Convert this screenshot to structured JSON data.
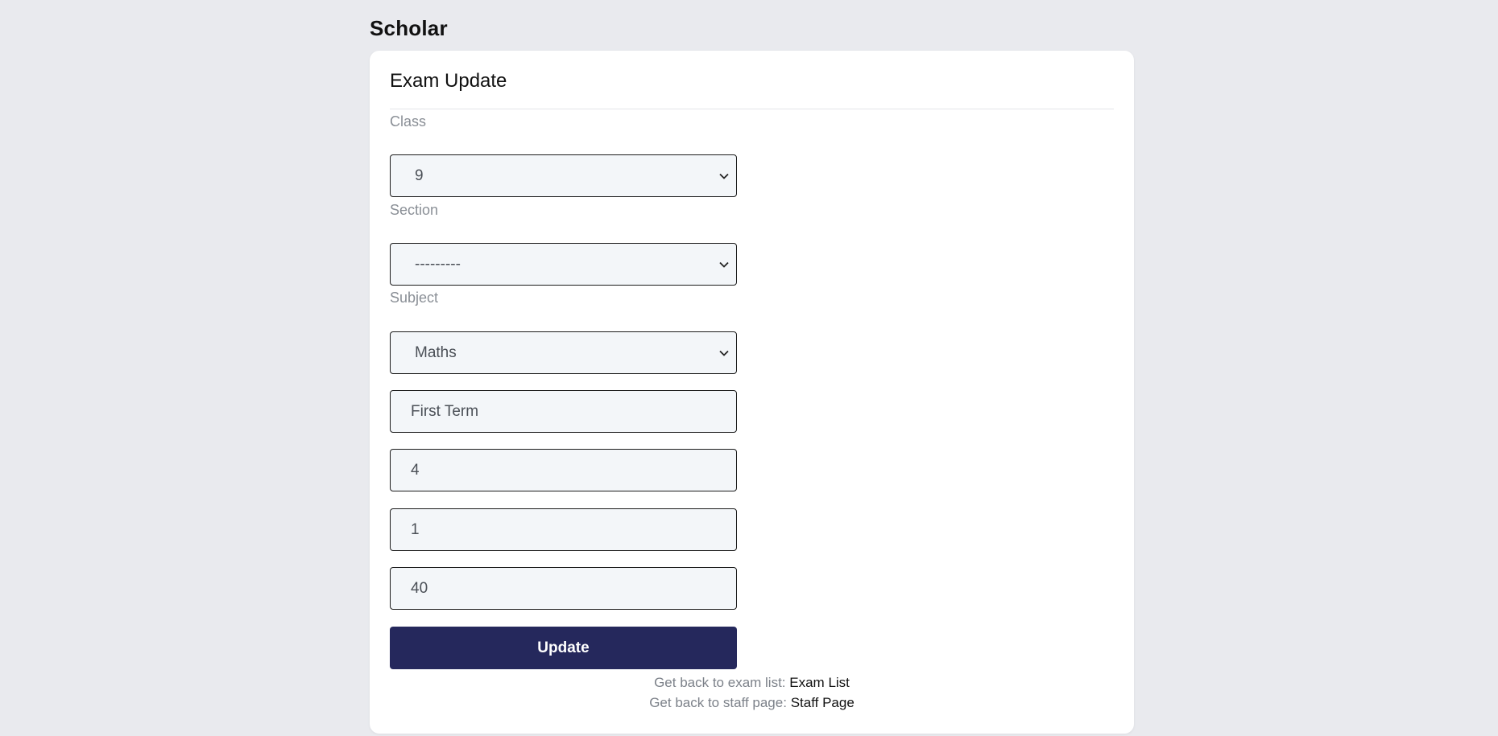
{
  "brand": "Scholar",
  "card": {
    "title": "Exam Update"
  },
  "form": {
    "class": {
      "label": "Class",
      "value": "9"
    },
    "section": {
      "label": "Section",
      "value": "---------"
    },
    "subject": {
      "label": "Subject",
      "value": "Maths"
    },
    "term": {
      "value": "First Term"
    },
    "field2": {
      "value": "4"
    },
    "field3": {
      "value": "1"
    },
    "field4": {
      "value": "40"
    },
    "submit_label": "Update"
  },
  "links": {
    "exam_list_prefix": "Get back to exam list:",
    "exam_list_link": "Exam List",
    "staff_prefix": "Get back to staff page:",
    "staff_link": "Staff Page"
  },
  "colors": {
    "page_bg": "#e9eaee",
    "card_bg": "#ffffff",
    "field_bg": "#f3f6f9",
    "button_bg": "#25285c"
  },
  "icons": {
    "select_chevron": "chevron-down-icon"
  }
}
